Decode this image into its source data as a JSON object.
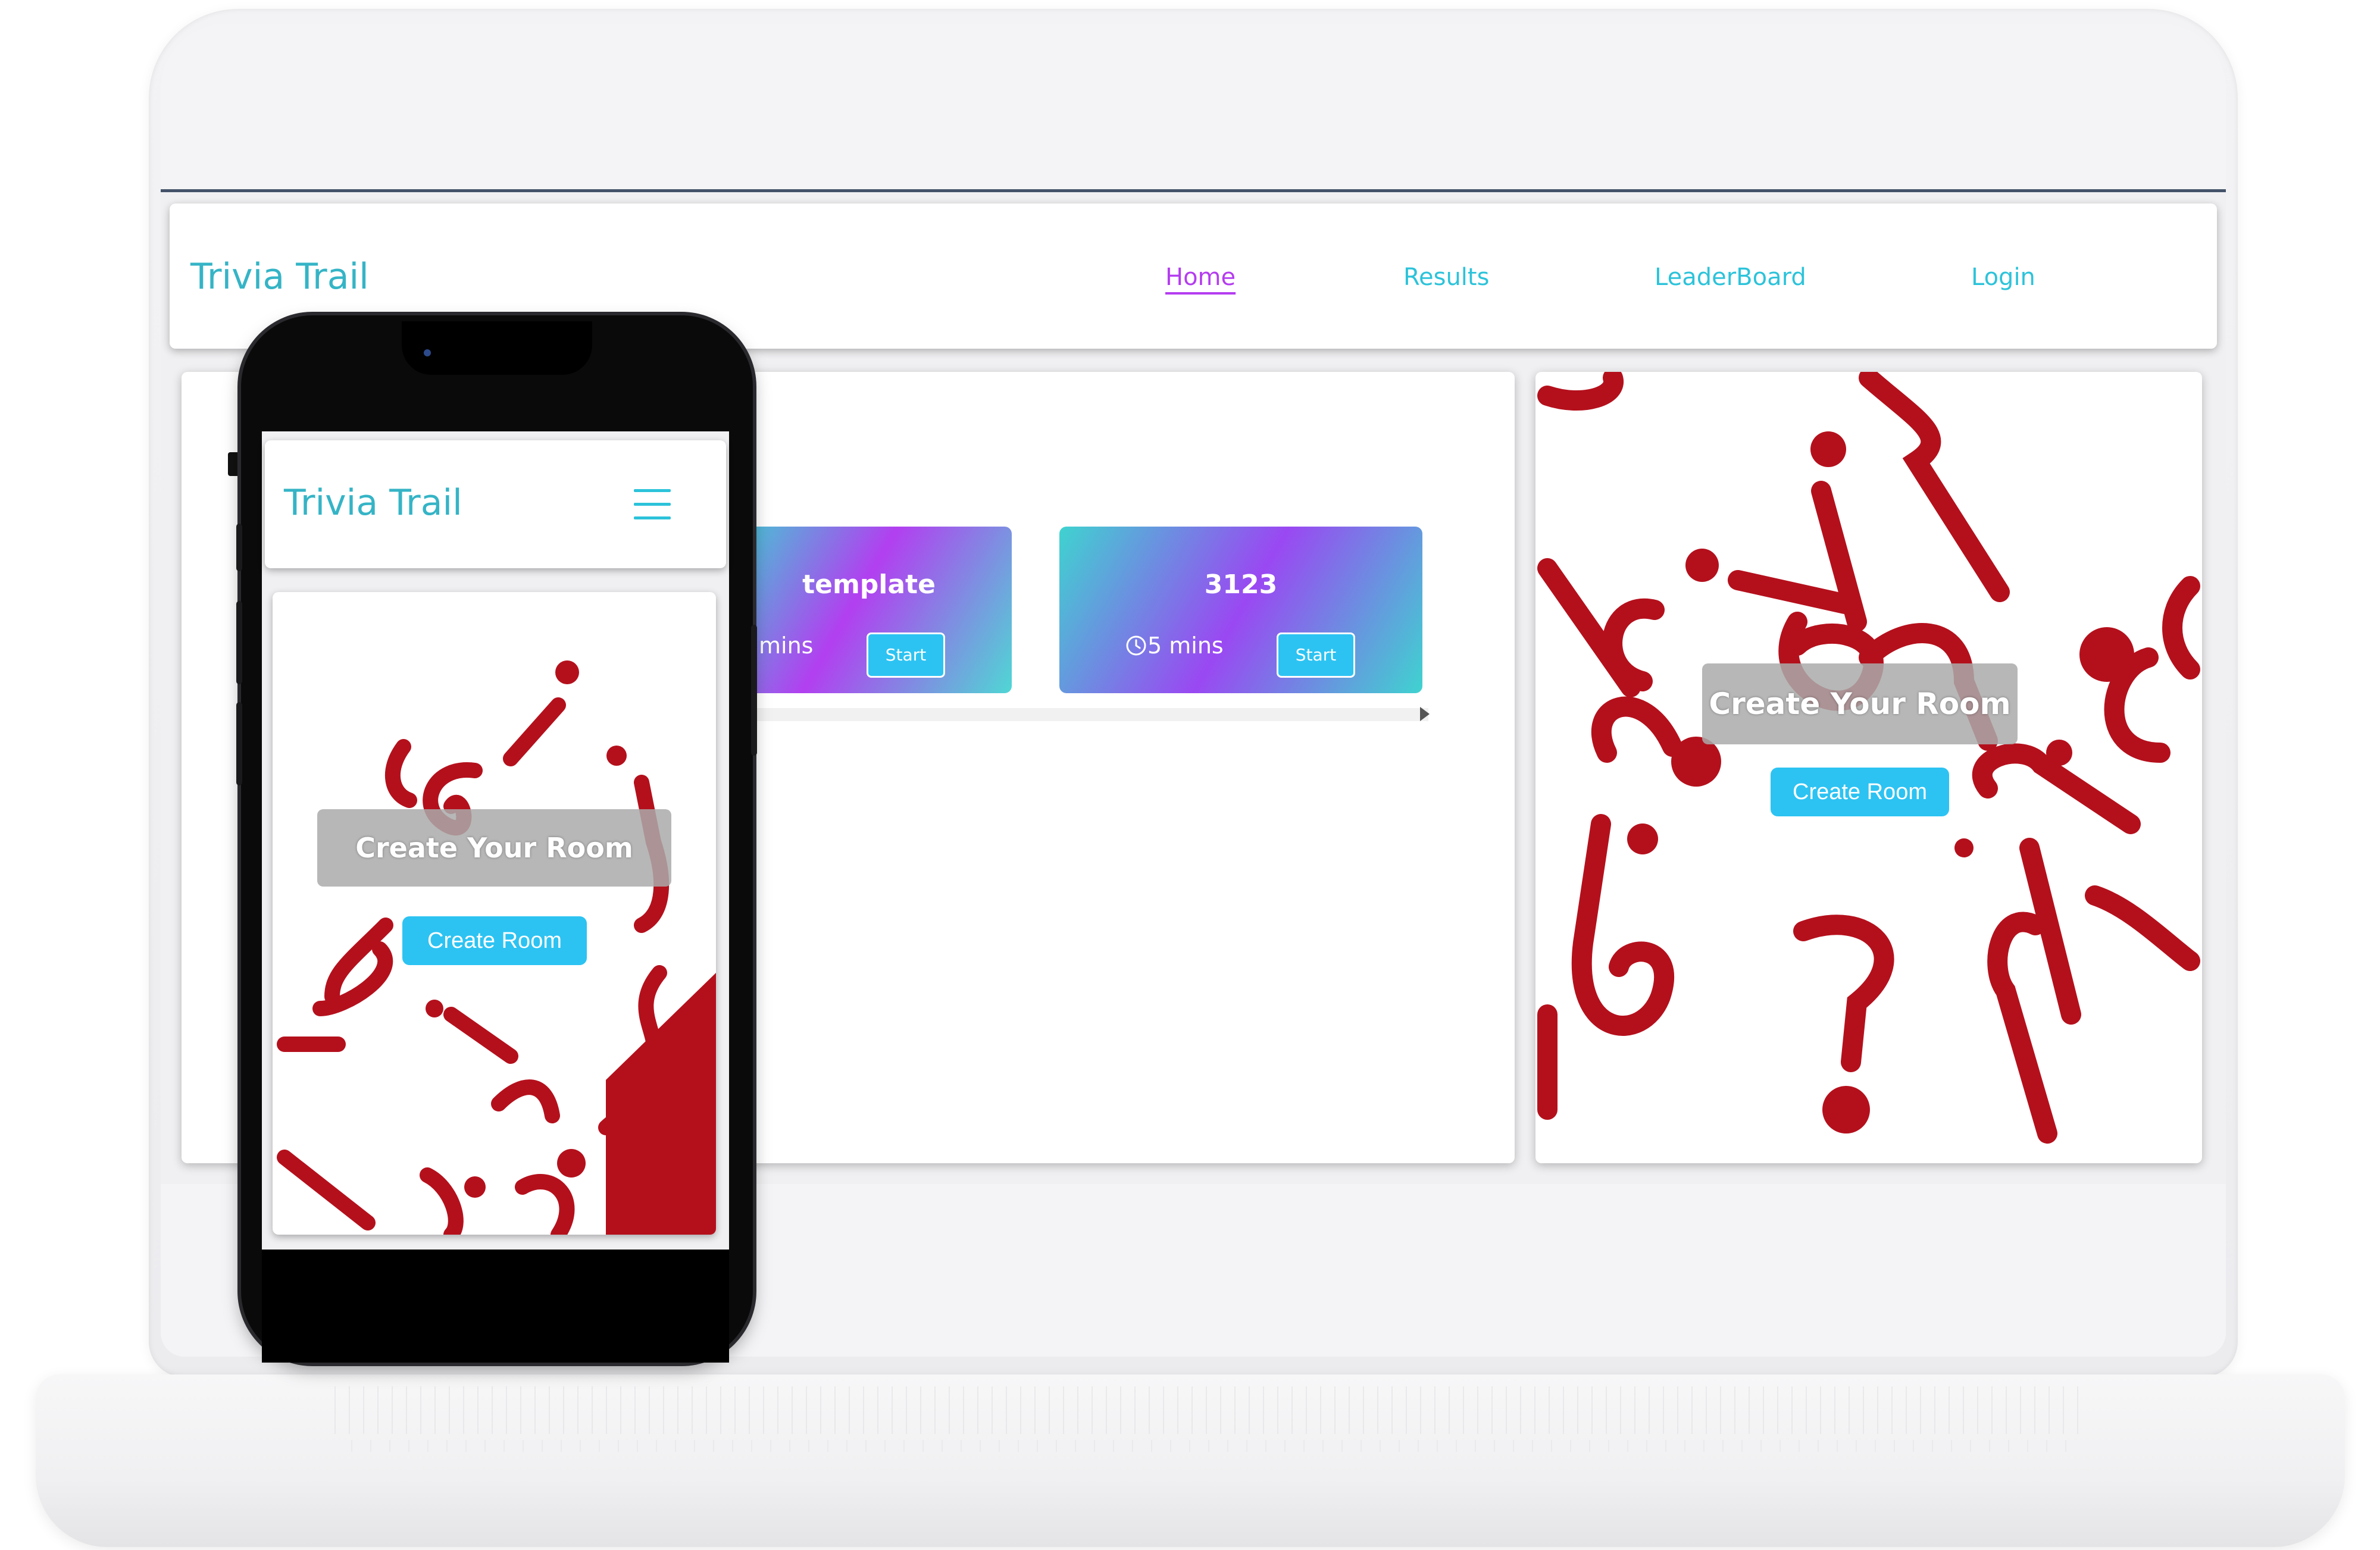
{
  "desktop": {
    "navbar": {
      "brand": "Trivia Trail",
      "links": [
        {
          "label": "Home",
          "active": true
        },
        {
          "label": "Results",
          "active": false
        },
        {
          "label": "LeaderBoard",
          "active": false
        },
        {
          "label": "Login",
          "active": false
        }
      ]
    },
    "quizzes": [
      {
        "title": "template",
        "time": "mins",
        "start_label": "Start"
      },
      {
        "title": "3123",
        "time": "5 mins",
        "start_label": "Start"
      }
    ],
    "create_panel": {
      "heading": "Create Your Room",
      "button_label": "Create Room"
    }
  },
  "mobile": {
    "brand": "Trivia Trail",
    "menu_icon": "hamburger-menu-icon",
    "create_panel": {
      "heading": "Create Your Room",
      "button_label": "Create Room"
    }
  },
  "colors": {
    "brand": "#35b4c6",
    "nav_link": "#2cc3da",
    "nav_active": "#b43cf0",
    "button": "#2cc3f2",
    "question_mark_red": "#c1121f"
  }
}
